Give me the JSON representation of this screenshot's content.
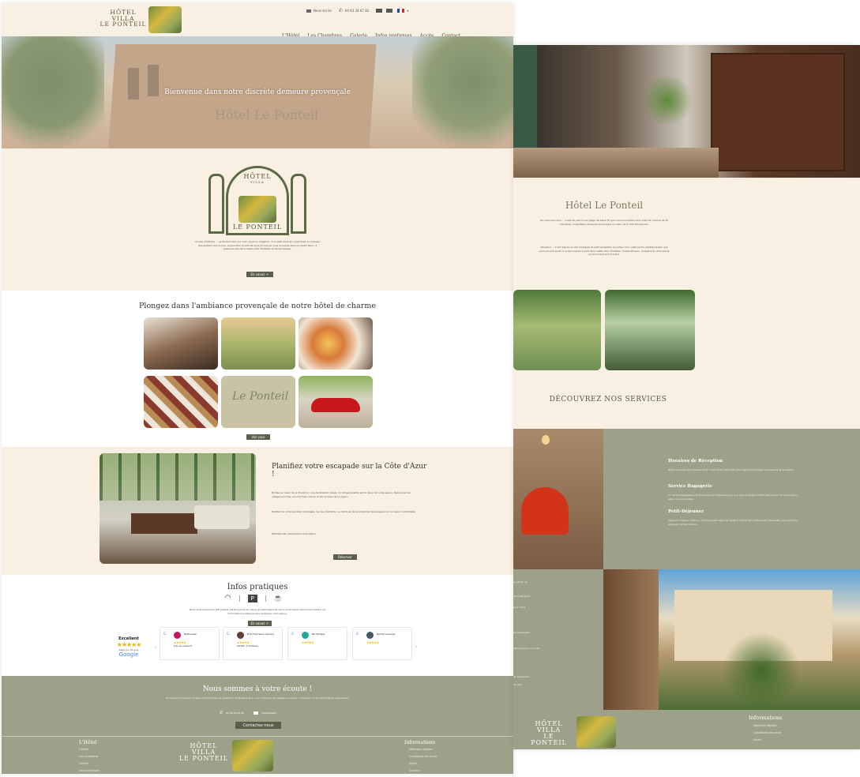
{
  "header": {
    "logo_line1": "HÔTEL",
    "logo_line2": "VILLA",
    "logo_line3": "LE PONTEIL",
    "topbar_email": "Nous écrire",
    "topbar_phone": "04 93 34 67 82",
    "nav": [
      "L'Hôtel",
      "Les Chambres",
      "Galerie",
      "Infos pratiques",
      "Accès",
      "Contact"
    ]
  },
  "hero": {
    "title": "Bienvenue dans notre discrète demeure provençale",
    "sign_text": "Hôtel Le Ponteil"
  },
  "intro": {
    "logo_top": "HÔTEL",
    "logo_mid": "VILLA",
    "logo_bottom": "LE PONTEIL",
    "paragraph": "Un peu d'histoire … Le Ponteil tient son nom, peut-on imaginer, d'un petit pont qui enjambait un ruisseau descendant vers la mer. Aujourd'hui la villa de style provençal vous accueille dans un jardin fleuri, à quelques pas de la vieille ville d'Antibes et de ses plages.",
    "button": "En savoir +"
  },
  "ambiance": {
    "title": "Plongez dans l'ambiance provençale de notre hôtel de charme",
    "button": "Voir plus",
    "photos": [
      "bedroom-photo",
      "villa-garden-photo",
      "breakfast-photo",
      "tiles-photo",
      "le-ponteil-sign-photo",
      "red-car-photo"
    ]
  },
  "plan": {
    "title": "Planifiez votre escapade sur la Côte d'Azur !",
    "paragraph1": "Nichée au cœur de la Provence, une destination idéale, ce refuge paisible est le décor de votre séjour. Découvrez les villages perchés, les marchés colorés et les musées de la région.",
    "paragraph2": "Profitez de notre terrasse ombragée, de nos chambres au calme et de la proximité des plages pour un séjour inoubliable.",
    "paragraph3": "Planifiez dès maintenant votre séjour.",
    "button": "Réserver"
  },
  "infos": {
    "title": "Infos pratiques",
    "paragraph": "Nous vous proposons wifi gratuit, parking privé sur place et petit-déjeuner servi en terrasse. Découvrez toutes nos informations pratiques pour préparer votre séjour.",
    "button": "En savoir +",
    "rating_label": "Excellent",
    "rating_stars": "★★★★★",
    "rating_sub": "Basé sur 96 avis",
    "rating_brand": "Google",
    "reviews": [
      {
        "name": "Nathanaël",
        "stars": "★★★★★",
        "text": "très accueillant",
        "color": "#c2185b",
        "initial": "N"
      },
      {
        "name": "Eva Francesca Carrara",
        "stars": "★★★★★",
        "text": "Parfait, à Antibes!",
        "color": "#5d4037",
        "initial": "E"
      },
      {
        "name": "Bw Phillipe",
        "stars": "★★★★★",
        "text": "",
        "color": "#26a69a",
        "initial": "B"
      },
      {
        "name": "Rachid Lucenas",
        "stars": "★★★★★",
        "text": "",
        "color": "#455a64",
        "initial": "R"
      }
    ]
  },
  "contact": {
    "title": "Nous sommes à votre écoute !",
    "paragraph": "Nous serons heureux de répondre à toutes vos questions. N'hésitez pas à nous contacter par téléphone ou par e-mail pour toute demande de réservation.",
    "phone": "04 93 34 67 82",
    "email": "info@hotel.fr",
    "button": "Contactez-nous"
  },
  "footer": {
    "col1_title": "L'Hôtel",
    "col1_links": [
      "L'Hôtel",
      "Les Chambres",
      "Galerie",
      "Infos pratiques"
    ],
    "logo_line1": "HÔTEL",
    "logo_line2": "VILLA",
    "logo_line3": "LE PONTEIL",
    "col2_title": "Informations",
    "col2_links": [
      "Mentions légales",
      "Conditions de vente",
      "Accès",
      "Contact"
    ]
  },
  "right_page": {
    "title": "Hôtel Le Ponteil",
    "para1": "Qui sommes-nous … C'est au pied d'une plage de sable fin que vous trouverez notre hôtel de charme de 15 chambres, magnifique demeure provençale au cœur de la Villa Provençale.",
    "para2": "Situation … C'est depuis ce site privilégié de petit ensemble au milieu d'un vaste jardin méditerranéen que vous pourrez partir à la découverte à pied de la vieille ville d'Antibes, musée Picasso, remparts du XVIe siècle qui dominent le Fort Carré.",
    "services_title": "DÉCOUVREZ NOS SERVICES",
    "services": [
      {
        "title": "Horaires de Réception",
        "text": "Notre réception est ouverte de 8h à 12h et de 14h à 20h pour répondre à toutes vos besoins et questions."
      },
      {
        "title": "Service Bagagerie",
        "text": "Un service bagagerie est disponible sur demande pour que vous puissiez profiter pleinement de votre séjour, sans vous encombrer."
      },
      {
        "title": "Petit-Déjeuner",
        "text": "Savourez chaque matin un délicieux petit-déjeuner de 8h à 10h30 dans notre jardin ensoleillé, avec produits régionaux et fait maison."
      }
    ],
    "side_snippets": [
      "au jardin de",
      "de toute sorte",
      "pour vivre",
      "et promenade",
      "des plus pour un bulle",
      "de personnes",
      "de plus"
    ],
    "footer_logo_line1": "HÔTEL",
    "footer_logo_line2": "VILLA",
    "footer_logo_line3": "LE PONTEIL",
    "footer_col_title": "Informations",
    "footer_links": [
      "Mentions légales",
      "Conditions de vente",
      "Accès"
    ]
  }
}
